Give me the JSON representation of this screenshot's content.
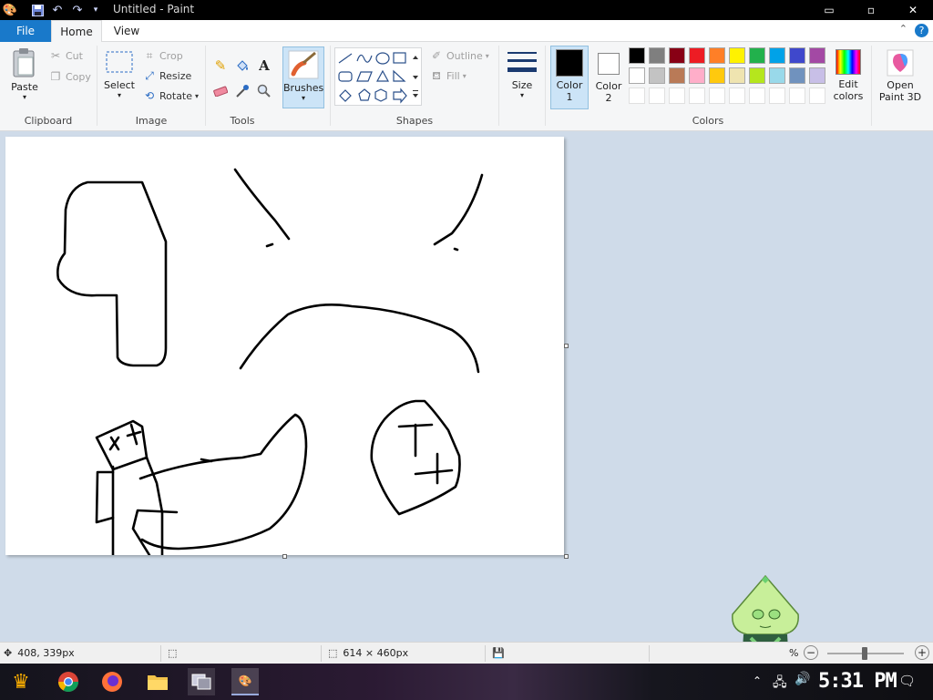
{
  "window": {
    "title": "Untitled - Paint",
    "controls": {
      "minimize": "▭",
      "maximize": "▫",
      "close": "✕"
    }
  },
  "tabs": {
    "file": "File",
    "home": "Home",
    "view": "View"
  },
  "help_glyph": "?",
  "collapse_glyph": "⌃",
  "ribbon": {
    "clipboard": {
      "label": "Clipboard",
      "paste": "Paste",
      "cut": "Cut",
      "copy": "Copy"
    },
    "image": {
      "label": "Image",
      "select": "Select",
      "crop": "Crop",
      "resize": "Resize",
      "rotate": "Rotate"
    },
    "tools": {
      "label": "Tools"
    },
    "brushes": {
      "label": "Brushes"
    },
    "shapes": {
      "label": "Shapes",
      "outline": "Outline",
      "fill": "Fill"
    },
    "size": {
      "label": "Size"
    },
    "color1": {
      "line1": "Color",
      "line2": "1",
      "value": "#000000"
    },
    "color2": {
      "line1": "Color",
      "line2": "2",
      "value": "#ffffff"
    },
    "colors": {
      "label": "Colors"
    },
    "edit_colors": {
      "line1": "Edit",
      "line2": "colors"
    },
    "open_paint3d": {
      "line1": "Open",
      "line2": "Paint 3D"
    }
  },
  "palette": [
    [
      "#000000",
      "#7f7f7f",
      "#880015",
      "#ed1c24",
      "#ff7f27",
      "#fff200",
      "#22b14c",
      "#00a2e8",
      "#3f48cc",
      "#a349a4"
    ],
    [
      "#ffffff",
      "#c3c3c3",
      "#b97a57",
      "#ffaec9",
      "#ffc90e",
      "#efe4b0",
      "#b5e61d",
      "#99d9ea",
      "#7092be",
      "#c8bfe7"
    ],
    [
      "#ffffff",
      "#ffffff",
      "#ffffff",
      "#ffffff",
      "#ffffff",
      "#ffffff",
      "#ffffff",
      "#ffffff",
      "#ffffff",
      "#ffffff"
    ]
  ],
  "status": {
    "cursor_pos": "408, 339px",
    "canvas_size": "614 × 460px",
    "zoom_percent_suffix": "%"
  },
  "taskbar": {
    "clock": "5:31 PM"
  },
  "colors": {
    "accent": "#1979ca",
    "ribbon_bg": "#f5f6f7",
    "workspace_bg": "#cfdbe9"
  }
}
